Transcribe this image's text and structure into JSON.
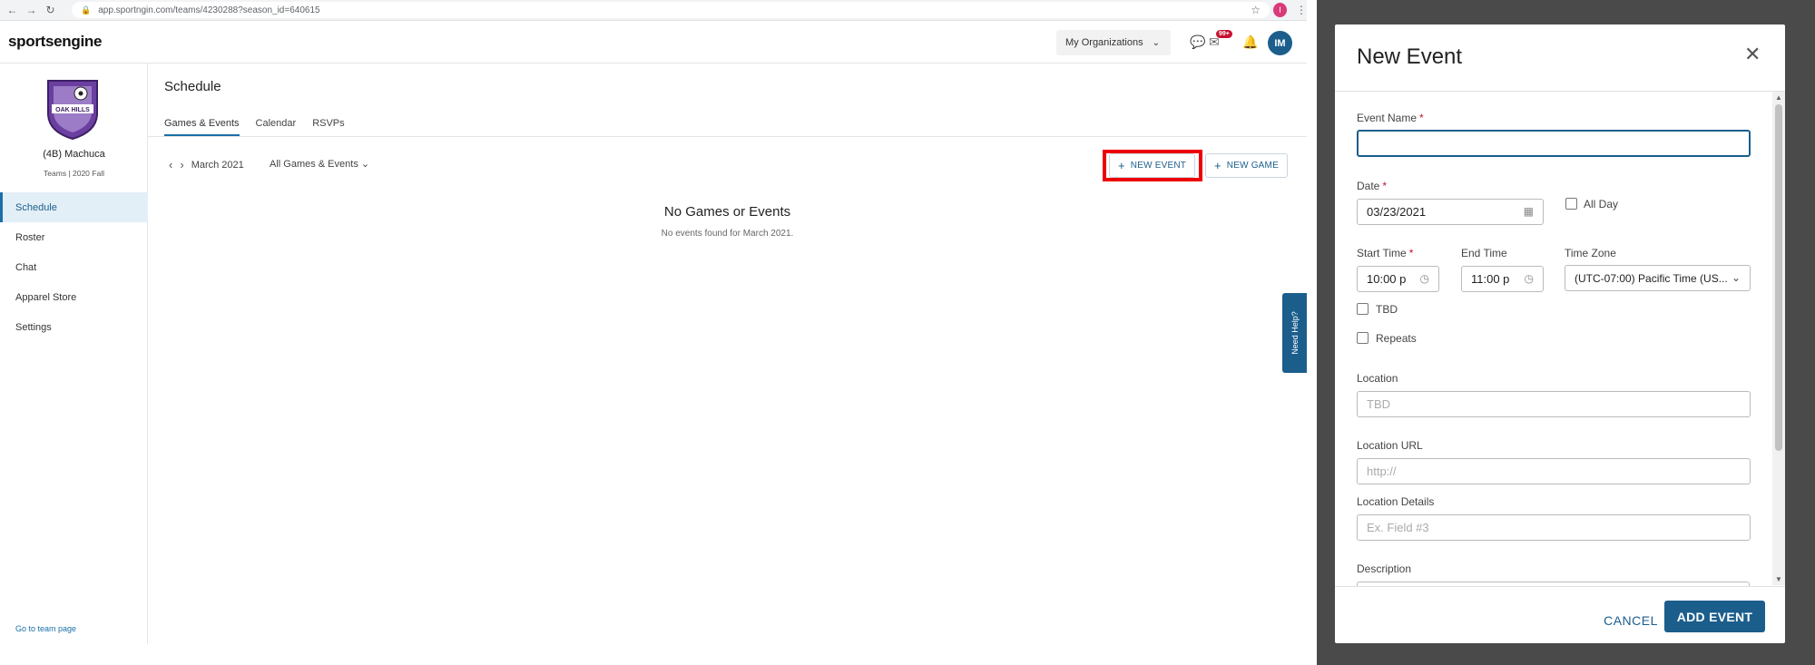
{
  "browser": {
    "url": "app.sportngin.com/teams/4230288?season_id=640615",
    "profile_initial": "I"
  },
  "header": {
    "logo": "sportsengine",
    "org_dropdown": "My Organizations",
    "mail_badge": "99+",
    "avatar_initials": "IM"
  },
  "sidebar": {
    "team_name": "(4B) Machuca",
    "team_sub": "Teams | 2020 Fall",
    "items": [
      {
        "label": "Schedule"
      },
      {
        "label": "Roster"
      },
      {
        "label": "Chat"
      },
      {
        "label": "Apparel Store"
      },
      {
        "label": "Settings"
      }
    ],
    "footer_link": "Go to team page"
  },
  "main": {
    "title": "Schedule",
    "tabs": [
      {
        "label": "Games & Events"
      },
      {
        "label": "Calendar"
      },
      {
        "label": "RSVPs"
      }
    ],
    "month": "March 2021",
    "filter": "All Games & Events",
    "new_event_label": "NEW EVENT",
    "new_game_label": "NEW GAME",
    "empty_title": "No Games or Events",
    "empty_sub": "No events found for March 2021.",
    "need_help": "Need Help?"
  },
  "modal": {
    "title": "New Event",
    "event_name_label": "Event Name",
    "event_name_value": "",
    "date_label": "Date",
    "date_value": "03/23/2021",
    "all_day_label": "All Day",
    "start_time_label": "Start Time",
    "start_time_value": "10:00 p",
    "end_time_label": "End Time",
    "end_time_value": "11:00 p",
    "time_zone_label": "Time Zone",
    "time_zone_value": "(UTC-07:00) Pacific Time (US...",
    "tbd_label": "TBD",
    "repeats_label": "Repeats",
    "location_label": "Location",
    "location_placeholder": "TBD",
    "location_url_label": "Location URL",
    "location_url_placeholder": "http://",
    "location_details_label": "Location Details",
    "location_details_placeholder": "Ex. Field #3",
    "description_label": "Description",
    "cancel_label": "CANCEL",
    "add_label": "ADD EVENT"
  },
  "colors": {
    "brand": "#1b5e8c",
    "highlight": "#ee0000",
    "overlay": "#4a4a4a"
  }
}
